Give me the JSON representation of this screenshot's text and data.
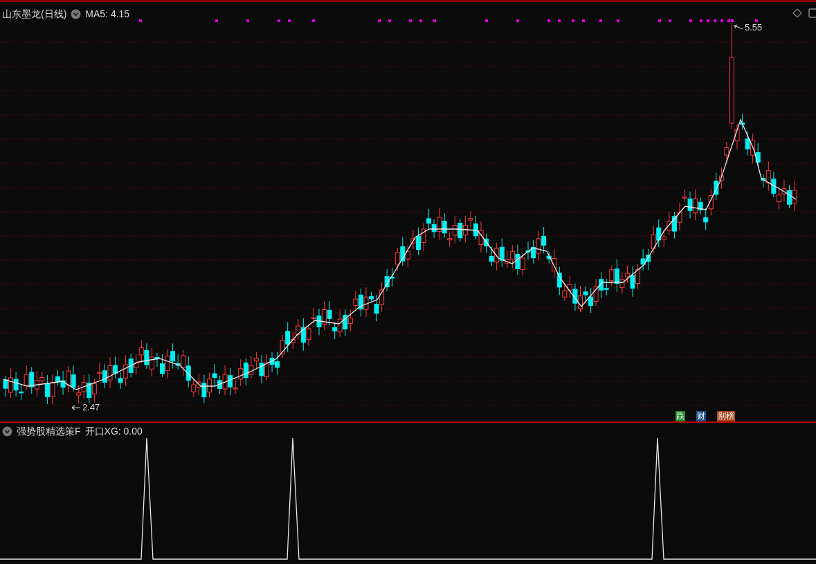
{
  "main_chart": {
    "title": "山东墨龙(日线)",
    "indicator": "MA5: 4.15",
    "high_label": "5.55",
    "low_label": "2.47",
    "badges": [
      {
        "text": "跌",
        "color": "#1c8a2a"
      },
      {
        "text": "财",
        "color": "#1f4f8c"
      },
      {
        "text": "别榜",
        "color": "#a8461e"
      }
    ]
  },
  "sub_chart": {
    "title": "强势股精选策F",
    "indicator": "开口XG: 0.00"
  }
}
